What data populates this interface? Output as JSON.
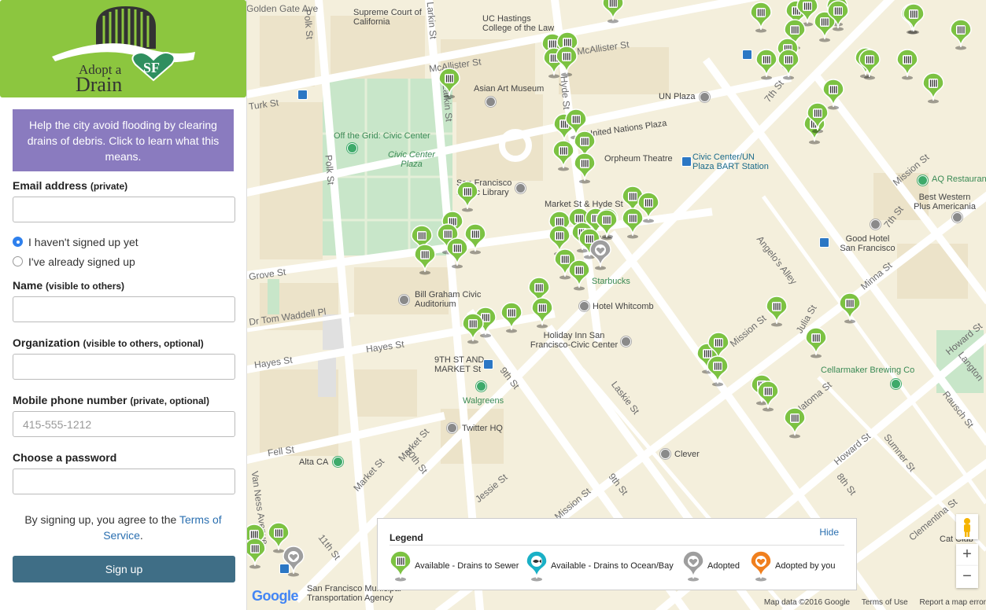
{
  "sidebar": {
    "logo_line1": "Adopt a",
    "logo_line2": "Drain",
    "logo_badge": "SF",
    "info": "Help the city avoid flooding by clearing drains of debris. Click to learn what this means.",
    "email_label": "Email address",
    "email_hint": "(private)",
    "radio_new": "I haven't signed up yet",
    "radio_existing": "I've already signed up",
    "name_label": "Name",
    "name_hint": "(visible to others)",
    "org_label": "Organization",
    "org_hint": "(visible to others, optional)",
    "phone_label": "Mobile phone number",
    "phone_hint": "(private, optional)",
    "phone_placeholder": "415-555-1212",
    "password_label": "Choose a password",
    "terms_prefix": "By signing up, you agree to the ",
    "terms_link": "Terms of Service",
    "terms_suffix": ".",
    "signup_label": "Sign up"
  },
  "legend": {
    "title": "Legend",
    "hide_label": "Hide",
    "items": [
      {
        "label": "Available - Drains to Sewer",
        "color": "#7cc242",
        "icon": "drain-grate-icon"
      },
      {
        "label": "Available - Drains to Ocean/Bay",
        "color": "#1ab0c6",
        "icon": "fish-icon"
      },
      {
        "label": "Adopted",
        "color": "#9e9e9e",
        "icon": "heart-icon"
      },
      {
        "label": "Adopted by you",
        "color": "#f07f1e",
        "icon": "heart-icon"
      }
    ]
  },
  "map": {
    "labels": {
      "supreme_court": "Supreme Court of California",
      "uc_hastings": "UC Hastings College of the Law",
      "asian_art": "Asian Art Museum",
      "un_plaza": "UN Plaza",
      "off_the_grid": "Off the Grid: Civic Center",
      "civic_center_plaza": "Civic Center Plaza",
      "united_nations_plaza": "United Nations Plaza",
      "orpheum": "Orpheum Theatre",
      "bart": "Civic Center/UN Plaza BART Station",
      "sf_library": "San Francisco Public Library",
      "market_hyde": "Market St & Hyde St",
      "aq_restaurant": "AQ Restaurant",
      "best_western": "Best Western Plus Americania",
      "good_hotel": "Good Hotel San Francisco",
      "starbucks": "Starbucks",
      "bill_graham": "Bill Graham Civic Auditorium",
      "hotel_whitcomb": "Hotel Whitcomb",
      "holiday_inn": "Holiday Inn San Francisco-Civic Center",
      "ninth_market": "9TH ST AND MARKET St",
      "walgreens": "Walgreens",
      "twitter": "Twitter HQ",
      "cellarmaker": "Cellarmaker Brewing Co",
      "clever": "Clever",
      "alta_ca": "Alta CA",
      "sfmta": "San Francisco Municipal Transportation Agency",
      "cat_club": "Cat Club",
      "street_mcallister": "McAllister St",
      "street_market": "Market St",
      "street_hayes": "Hayes St",
      "street_fell": "Fell St",
      "street_mission": "Mission St",
      "street_howard": "Howard St",
      "street_polk": "Polk St",
      "street_larkin": "Larkin St",
      "street_hyde": "Hyde St",
      "street_7th": "7th St",
      "street_8th": "8th St",
      "street_9th": "9th St",
      "street_10th": "10th St",
      "street_11th": "11th St",
      "street_jessie": "Jessie St",
      "street_laskie": "Laskie St",
      "street_minna": "Minna St",
      "street_natoma": "Natoma St",
      "street_angelos": "Angelo's Alley",
      "street_grove": "Grove St",
      "street_tom_waddell": "Dr Tom Waddell Pl",
      "street_van_ness": "Van Ness Avenue",
      "street_sumner": "Sumner St",
      "street_clementina": "Clementina St",
      "street_rausch": "Rausch St",
      "street_langton": "Langton",
      "street_julia": "Julia St",
      "street_golden_gate": "Golden Gate Ave",
      "street_turk": "Turk St"
    },
    "attribution": {
      "map_data": "Map data ©2016 Google",
      "terms": "Terms of Use",
      "report": "Report a map error"
    },
    "google": "Google"
  }
}
